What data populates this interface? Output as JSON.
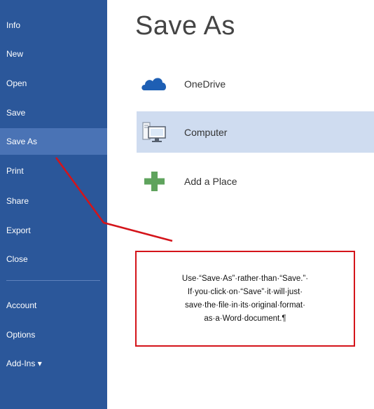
{
  "sidebar": {
    "items": [
      {
        "label": "Info"
      },
      {
        "label": "New"
      },
      {
        "label": "Open"
      },
      {
        "label": "Save"
      },
      {
        "label": "Save As",
        "active": true
      },
      {
        "label": "Print"
      },
      {
        "label": "Share"
      },
      {
        "label": "Export"
      },
      {
        "label": "Close"
      },
      {
        "label": "Account"
      },
      {
        "label": "Options"
      },
      {
        "label": "Add-Ins ▾"
      }
    ]
  },
  "main": {
    "title": "Save As",
    "places": [
      {
        "label": "OneDrive",
        "icon": "cloud-icon"
      },
      {
        "label": "Computer",
        "icon": "computer-icon",
        "selected": true
      },
      {
        "label": "Add a Place",
        "icon": "plus-icon"
      }
    ]
  },
  "annotation": {
    "text": "Use·“Save·As”·rather·than·“Save.”·\nIf·you·click·on·“Save”·it·will·just·\nsave·the·file·in·its·original·format·\nas·a·Word·document.¶",
    "border_color": "#d4141a"
  },
  "colors": {
    "sidebar_bg": "#2b579a",
    "sidebar_active": "#4a73b5",
    "selected_place": "#cfdcf0",
    "onedrive_blue": "#1e5fb4",
    "plus_green": "#5fa35d"
  }
}
